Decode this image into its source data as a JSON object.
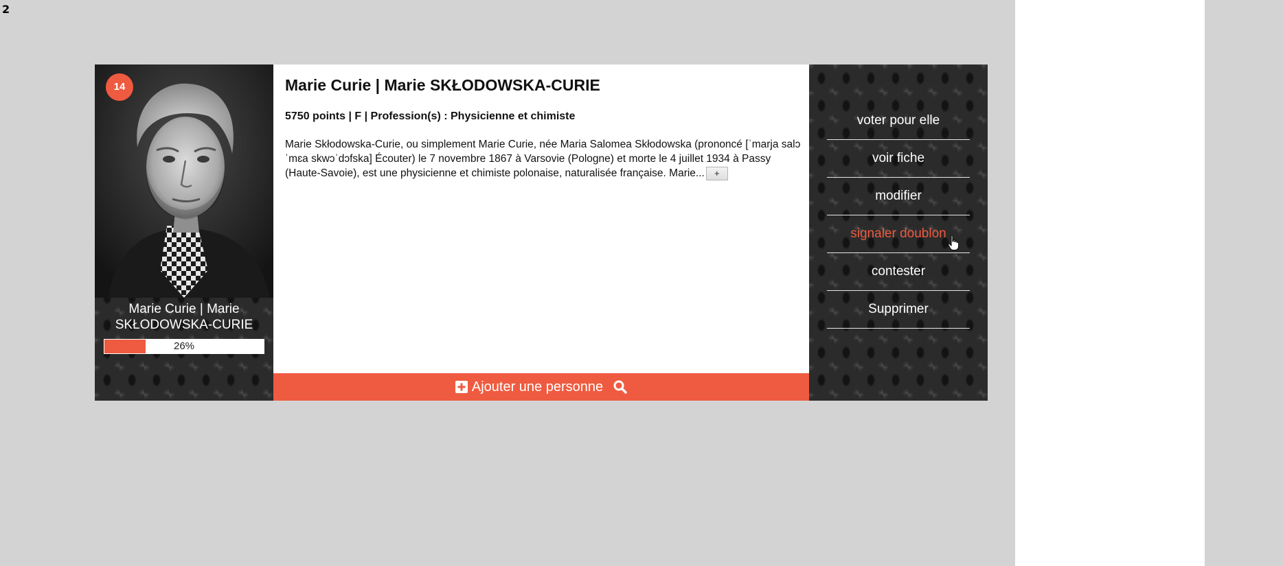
{
  "page_marker": "2",
  "person": {
    "rank": "14",
    "short_name": "Marie Curie | Marie SKŁODOWSKA-CURIE",
    "title": "Marie Curie | Marie SKŁODOWSKA-CURIE",
    "meta": "5750 points | F | Profession(s) : Physicienne et chimiste",
    "description": "Marie Skłodowska-Curie, ou simplement Marie Curie, née Maria Salomea Skłodowska (prononcé [ˈmarja salɔˈmɛa skwɔˈdɔfska] Écouter) le 7 novembre 1867 à Varsovie (Pologne) et morte le 4 juillet 1934 à Passy (Haute-Savoie), est une physicienne et chimiste polonaise, naturalisée française. Marie...",
    "more_label": "+",
    "progress_label": "26%",
    "progress_fraction": 0.26
  },
  "add_bar": {
    "label": "Ajouter une personne",
    "plus_icon": "plus-square-icon",
    "search_icon": "search-icon"
  },
  "actions": [
    {
      "label": "voter pour elle"
    },
    {
      "label": "voir fiche"
    },
    {
      "label": "modifier"
    },
    {
      "label": "signaler doublon"
    },
    {
      "label": "contester"
    },
    {
      "label": "Supprimer"
    }
  ],
  "colors": {
    "accent": "#ef5b40",
    "page_background": "#d3d3d3",
    "panel_dark": "#2b2b2b"
  }
}
